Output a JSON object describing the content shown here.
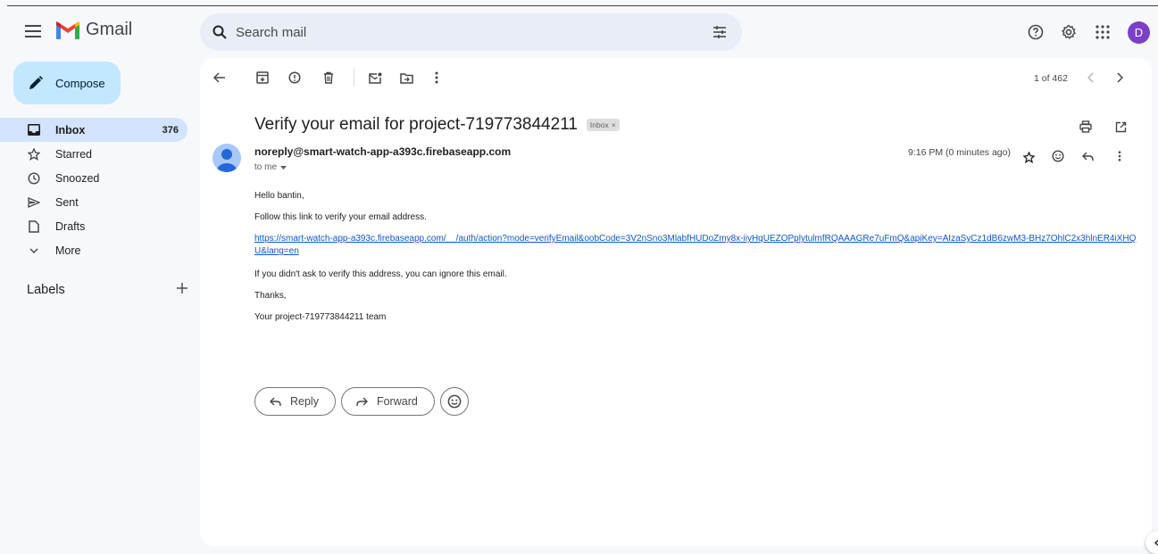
{
  "app": {
    "name": "Gmail",
    "avatar_letter": "D"
  },
  "search": {
    "placeholder": "Search mail"
  },
  "compose": {
    "label": "Compose"
  },
  "sidebar": {
    "items": [
      {
        "label": "Inbox",
        "count": "376",
        "icon": "inbox-icon"
      },
      {
        "label": "Starred",
        "icon": "star-icon"
      },
      {
        "label": "Snoozed",
        "icon": "clock-icon"
      },
      {
        "label": "Sent",
        "icon": "send-icon"
      },
      {
        "label": "Drafts",
        "icon": "draft-icon"
      },
      {
        "label": "More",
        "icon": "chevron-down-icon"
      }
    ],
    "labels_title": "Labels"
  },
  "pager": {
    "text": "1 of 462"
  },
  "email": {
    "subject": "Verify your email for project-719773844211",
    "chip": "Inbox",
    "sender": "noreply@smart-watch-app-a393c.firebaseapp.com",
    "to": "to me",
    "time": "9:16 PM (0 minutes ago)",
    "greeting": "Hello bantin,",
    "line1": "Follow this link to verify your email address.",
    "link": "https://smart-watch-app-a393c.firebaseapp.com/__/auth/action?mode=verifyEmail&oobCode=3V2nSno3MlabfHUDoZmy8x-iiyHqUEZOPplytulmfRQAAAGRe7uFmQ&apiKey=AIzaSyCz1dB6zwM3-BHz7OhlC2x3hlnER4iXHQU&lang=en",
    "line2": "If you didn't ask to verify this address, you can ignore this email.",
    "thanks": "Thanks,",
    "signature": "Your project-719773844211 team"
  },
  "actions": {
    "reply": "Reply",
    "forward": "Forward"
  },
  "colors": {
    "accent": "#c2e7ff",
    "active": "#d3e3fd",
    "link": "#1155cc",
    "avatar": "#7b3fc8"
  }
}
